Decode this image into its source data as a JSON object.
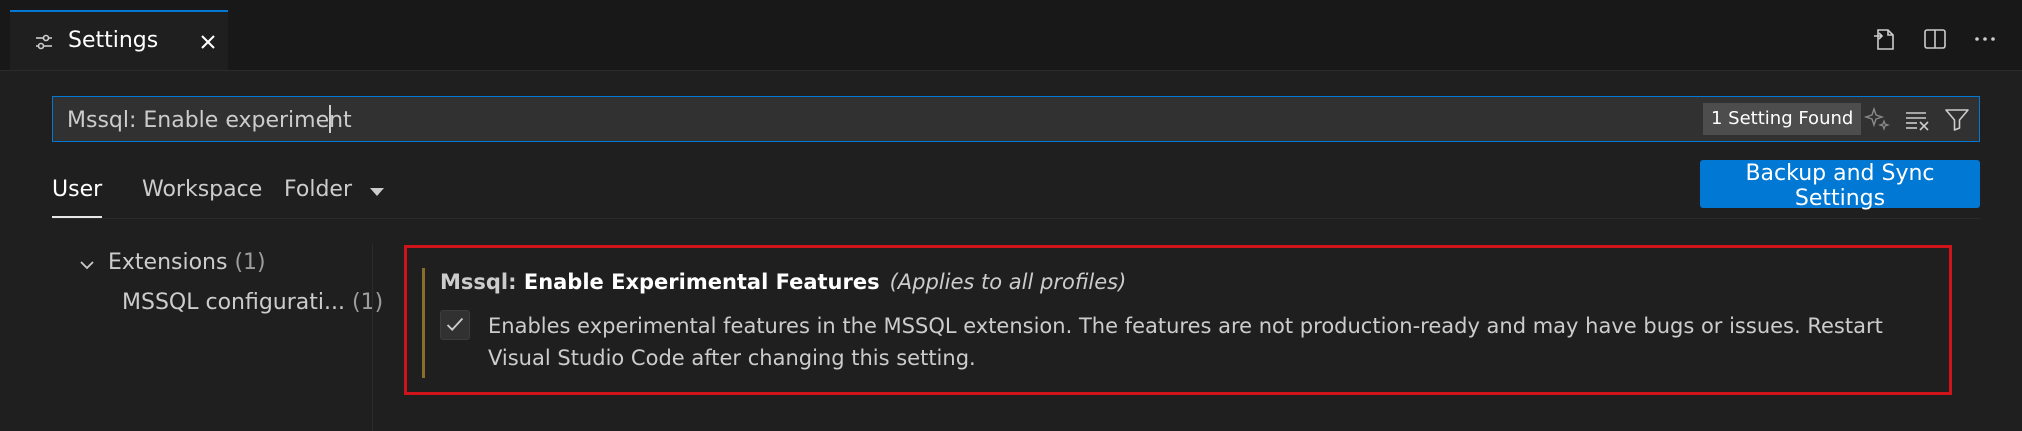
{
  "tab": {
    "label": "Settings",
    "icon": "settings-sliders-icon"
  },
  "editor_actions": [
    "open-settings-json-icon",
    "split-editor-icon",
    "more-actions-icon"
  ],
  "search": {
    "value": "Mssql: Enable experiment",
    "result_count": "1 Setting Found",
    "tools": [
      "sparkle-icon",
      "clear-filter-icon",
      "filter-icon"
    ]
  },
  "scopes": {
    "user": "User",
    "workspace": "Workspace",
    "folder": "Folder"
  },
  "sync_button": "Backup and Sync Settings",
  "toc": {
    "group_label": "Extensions",
    "group_count": "(1)",
    "child_label": "MSSQL configurati...",
    "child_count": "(1)"
  },
  "setting": {
    "category": "Mssql: ",
    "name": "Enable Experimental Features",
    "scope_note": "(Applies to all profiles)",
    "checked": true,
    "description": "Enables experimental features in the MSSQL extension. The features are not production-ready and may have bugs or issues. Restart Visual Studio Code after changing this setting."
  },
  "colors": {
    "accent": "#0078d4",
    "highlight_border": "#d0121a",
    "background": "#1f1f1f"
  }
}
